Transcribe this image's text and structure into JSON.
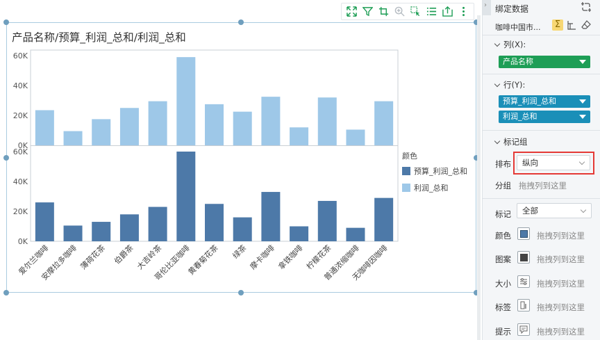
{
  "toolbar": {
    "icons": [
      "expand-icon",
      "filter-icon",
      "drill-icon",
      "zoom-icon",
      "select-icon",
      "list-icon",
      "export-icon",
      "more-icon"
    ]
  },
  "chart": {
    "title": "产品名称/预算_利润_总和/利润_总和"
  },
  "chart_data": {
    "type": "bar",
    "title": "产品名称/预算_利润_总和/利润_总和",
    "categories": [
      "爱尔兰咖啡",
      "安摩拉多咖啡",
      "薄荷花茶",
      "伯爵茶",
      "大吉岭茶",
      "哥伦比亚咖啡",
      "黄春菊花茶",
      "绿茶",
      "摩卡咖啡",
      "拿铁咖啡",
      "柠檬花茶",
      "普通浓缩咖啡",
      "无咖啡因咖啡"
    ],
    "series": [
      {
        "name": "利润_总和",
        "color": "#9ec8e8",
        "values": [
          23500,
          9500,
          17500,
          25000,
          29500,
          59000,
          27500,
          22500,
          32500,
          12000,
          32000,
          10500,
          29500
        ]
      },
      {
        "name": "预算_利润_总和",
        "color": "#4d79a8",
        "values": [
          26000,
          10500,
          13000,
          18000,
          23000,
          60000,
          25000,
          16000,
          33000,
          10000,
          27000,
          9000,
          29000
        ]
      }
    ],
    "panels": [
      {
        "series": "利润_总和",
        "ylim": [
          0,
          60000
        ],
        "yticks": [
          "0K",
          "20K",
          "40K",
          "60K"
        ]
      },
      {
        "series": "预算_利润_总和",
        "ylim": [
          0,
          60000
        ],
        "yticks": [
          "0K",
          "20K",
          "40K",
          "60K"
        ]
      }
    ],
    "legend": {
      "title": "颜色",
      "placement": "right"
    },
    "grid": false
  },
  "panel": {
    "header": "绑定数据",
    "dataset": "咖啡中国市...",
    "columns_label": "列(X):",
    "columns": [
      {
        "label": "产品名称",
        "color": "#1e9e56"
      }
    ],
    "rows_label": "行(Y):",
    "rows": [
      {
        "label": "预算_利润_总和",
        "color": "#1a8fb8"
      },
      {
        "label": "利润_总和",
        "color": "#1a8fb8"
      }
    ],
    "marks_group": "标记组",
    "distribution_label": "排布",
    "distribution_value": "纵向",
    "group_label": "分组",
    "drag_hint": "拖拽列到这里",
    "mark_label": "标记",
    "mark_value": "全部",
    "properties": [
      {
        "label": "颜色",
        "hint": "拖拽列到这里"
      },
      {
        "label": "图案",
        "hint": "拖拽列到这里"
      },
      {
        "label": "大小",
        "hint": "拖拽列到这里"
      },
      {
        "label": "标签",
        "hint": "拖拽列到这里"
      },
      {
        "label": "提示",
        "hint": "拖拽列到这里"
      }
    ]
  }
}
